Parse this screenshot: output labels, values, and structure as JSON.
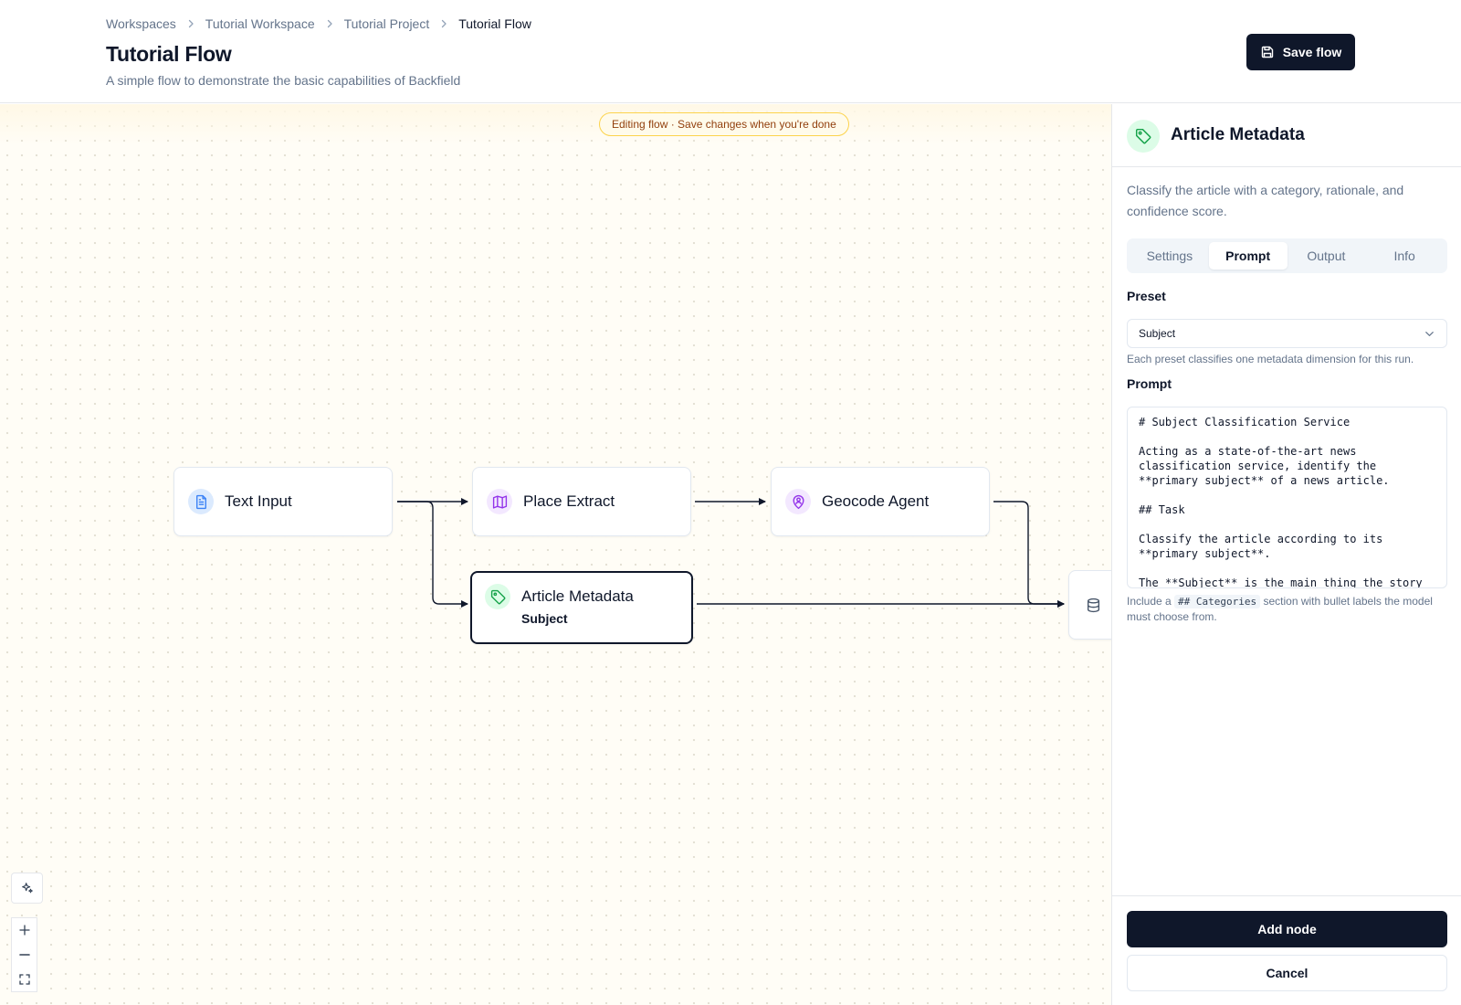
{
  "header": {
    "breadcrumb": [
      "Workspaces",
      "Tutorial Workspace",
      "Tutorial Project",
      "Tutorial Flow"
    ],
    "title": "Tutorial Flow",
    "subtitle": "A simple flow to demonstrate the basic capabilities of Backfield",
    "save_label": "Save flow"
  },
  "canvas": {
    "banner": "Editing flow · Save changes when you're done",
    "nodes": {
      "text_input": {
        "label": "Text Input",
        "icon": "file-text-icon"
      },
      "place_extract": {
        "label": "Place Extract",
        "icon": "map-icon"
      },
      "geocode_agent": {
        "label": "Geocode Agent",
        "icon": "user-pin-icon"
      },
      "article_metadata": {
        "label": "Article Metadata",
        "sublabel": "Subject",
        "icon": "tag-icon"
      },
      "output": {
        "label": "",
        "icon": "database-icon"
      }
    },
    "controls": [
      "sparkle-icon",
      "zoom-in-icon",
      "zoom-out-icon",
      "fit-view-icon"
    ]
  },
  "panel": {
    "title": "Article Metadata",
    "icon": "tag-icon",
    "description": "Classify the article with a category, rationale, and confidence score.",
    "tabs": [
      "Settings",
      "Prompt",
      "Output",
      "Info"
    ],
    "active_tab": "Prompt",
    "preset": {
      "label": "Preset",
      "value": "Subject",
      "hint": "Each preset classifies one metadata dimension for this run."
    },
    "prompt": {
      "label": "Prompt",
      "value": "# Subject Classification Service\n\nActing as a state-of-the-art news classification service, identify the **primary subject** of a news article.\n\n## Task\n\nClassify the article according to its **primary subject**.\n\nThe **Subject** is the main thing the story",
      "hint_pre": "Include a",
      "hint_code": "## Categories",
      "hint_post": "section with bullet labels the model must choose from."
    },
    "add_label": "Add node",
    "cancel_label": "Cancel"
  },
  "colors": {
    "primary": "#0f172a",
    "banner_border": "#fcd34d",
    "banner_text": "#92400e",
    "canvas_bg": "#fffdf6"
  }
}
